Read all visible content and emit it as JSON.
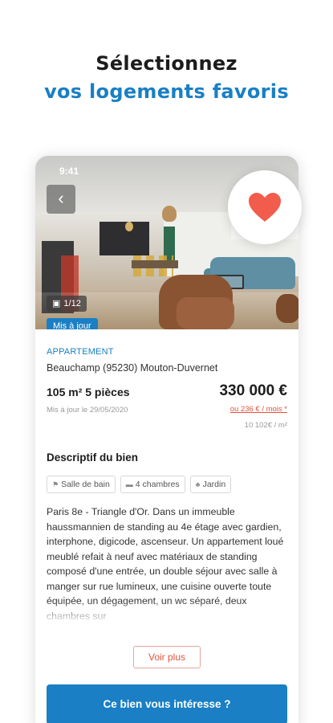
{
  "headline": {
    "line1": "Sélectionnez",
    "line2": "vos logements favoris"
  },
  "status_bar": {
    "time": "9:41"
  },
  "photo": {
    "back_icon": "chevron-left-icon",
    "counter": "1/12",
    "counter_icon": "camera-icon",
    "badge": "Mis à jour"
  },
  "favorite": {
    "icon": "heart-icon",
    "color": "#f25c4c"
  },
  "listing": {
    "type": "APPARTEMENT",
    "location": "Beauchamp (95230) Mouton-Duvernet",
    "surface_rooms": "105 m²   5 pièces",
    "price": "330 000 €",
    "updated": "Mis à jour le 29/05/2020",
    "monthly": "ou 236 € / mois *",
    "price_per_sqm": "10 102€ / m²"
  },
  "description": {
    "title": "Descriptif du bien",
    "tags": [
      {
        "icon": "bath-icon",
        "label": "Salle de bain"
      },
      {
        "icon": "bed-icon",
        "label": "4 chambres"
      },
      {
        "icon": "tree-icon",
        "label": "Jardin"
      }
    ],
    "text": "Paris 8e - Triangle d'Or. Dans un immeuble haussmannien de standing au 4e étage avec gardien, interphone, digicode, ascenseur. Un appartement loué meublé refait à neuf avec matériaux de standing composé d'une entrée, un double séjour avec salle à manger sur rue lumineux, une cuisine ouverte toute équipée, un dégagement, un wc séparé, deux chambres sur",
    "more_label": "Voir plus"
  },
  "cta": {
    "label": "Ce bien vous intéresse ?"
  },
  "colors": {
    "accent": "#1a7fc4",
    "alert": "#e0533c"
  }
}
